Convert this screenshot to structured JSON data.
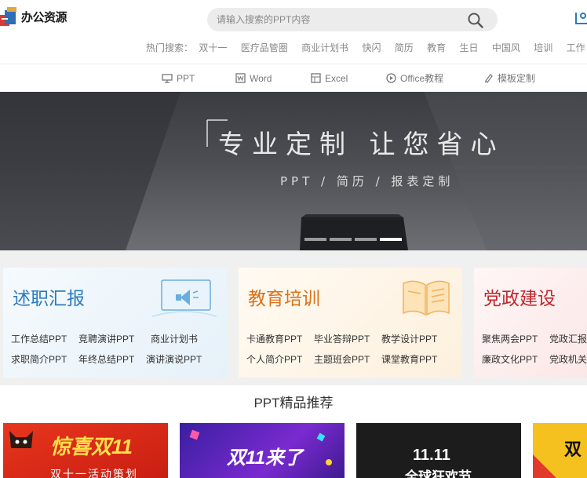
{
  "header": {
    "logo_text": "办公资源",
    "search_placeholder": "请输入搜索的PPT内容",
    "hot_label": "热门搜索：",
    "hot_terms": [
      "双十一",
      "医疗品管圈",
      "商业计划书",
      "快闪",
      "简历",
      "教育",
      "生日",
      "中国风",
      "培训",
      "工作"
    ]
  },
  "nav": {
    "items": [
      {
        "label": "PPT",
        "icon": "presentation-icon"
      },
      {
        "label": "Word",
        "icon": "word-icon"
      },
      {
        "label": "Excel",
        "icon": "excel-icon"
      },
      {
        "label": "Office教程",
        "icon": "play-icon"
      },
      {
        "label": "模板定制",
        "icon": "brush-icon"
      }
    ]
  },
  "banner": {
    "title": "专业定制  让您省心",
    "subtitle": "PPT / 简历 / 报表定制",
    "slide_count": 4,
    "active_slide": 4
  },
  "categories": [
    {
      "title": "述职汇报",
      "links": [
        [
          "工作总结PPT",
          "竞聘演讲PPT",
          "商业计划书"
        ],
        [
          "求职简介PPT",
          "年终总结PPT",
          "演讲演说PPT"
        ]
      ]
    },
    {
      "title": "教育培训",
      "links": [
        [
          "卡通教育PPT",
          "毕业答辩PPT",
          "教学设计PPT"
        ],
        [
          "个人简介PPT",
          "主题班会PPT",
          "课堂教育PPT"
        ]
      ]
    },
    {
      "title": "党政建设",
      "links": [
        [
          "聚焦两会PPT",
          "党政汇报"
        ],
        [
          "廉政文化PPT",
          "党政机关"
        ]
      ]
    }
  ],
  "recommend": {
    "title": "PPT精品推荐",
    "thumbs": [
      {
        "text": "惊喜双11",
        "caption": "双十一活动策划"
      },
      {
        "text": "双11来了",
        "caption": ""
      },
      {
        "text": "11.11",
        "caption": "全球狂欢节"
      },
      {
        "text": "双",
        "caption": ""
      }
    ]
  },
  "colors": {
    "card1_title": "#2b7bbf",
    "card2_title": "#d9721a",
    "card3_title": "#c0262c",
    "banner_bg": "#4a4c51"
  }
}
